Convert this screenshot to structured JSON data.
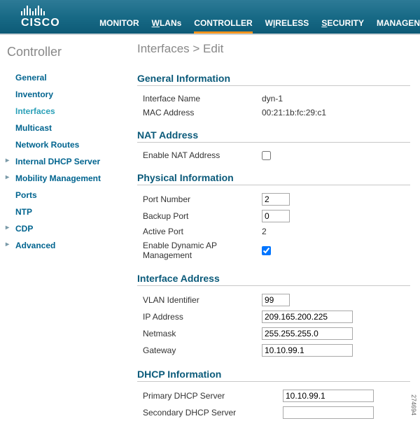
{
  "brand": "CISCO",
  "tabs": {
    "monitor": "MONITOR",
    "wlans": "WLANs",
    "controller": "CONTROLLER",
    "wireless": "WIRELESS",
    "security": "SECURITY",
    "manage": "MANAGEN"
  },
  "activeTab": "CONTROLLER",
  "sidebar": {
    "title": "Controller",
    "items": [
      "General",
      "Inventory",
      "Interfaces",
      "Multicast",
      "Network Routes",
      "Internal DHCP Server",
      "Mobility Management",
      "Ports",
      "NTP",
      "CDP",
      "Advanced"
    ]
  },
  "breadcrumb": "Interfaces > Edit",
  "sections": {
    "general": {
      "title": "General Information",
      "iface_label": "Interface Name",
      "iface_value": "dyn-1",
      "mac_label": "MAC Address",
      "mac_value": "00:21:1b:fc:29:c1"
    },
    "nat": {
      "title": "NAT Address",
      "enable_label": "Enable NAT Address",
      "enable_value": false
    },
    "physical": {
      "title": "Physical Information",
      "port_label": "Port Number",
      "port_value": "2",
      "backup_label": "Backup Port",
      "backup_value": "0",
      "active_label": "Active Port",
      "active_value": "2",
      "dynap_label": "Enable Dynamic AP Management",
      "dynap_value": true
    },
    "address": {
      "title": "Interface Address",
      "vlan_label": "VLAN Identifier",
      "vlan_value": "99",
      "ip_label": "IP Address",
      "ip_value": "209.165.200.225",
      "mask_label": "Netmask",
      "mask_value": "255.255.255.0",
      "gw_label": "Gateway",
      "gw_value": "10.10.99.1"
    },
    "dhcp": {
      "title": "DHCP Information",
      "primary_label": "Primary DHCP Server",
      "primary_value": "10.10.99.1",
      "secondary_label": "Secondary DHCP Server",
      "secondary_value": ""
    }
  },
  "ref": "274694"
}
